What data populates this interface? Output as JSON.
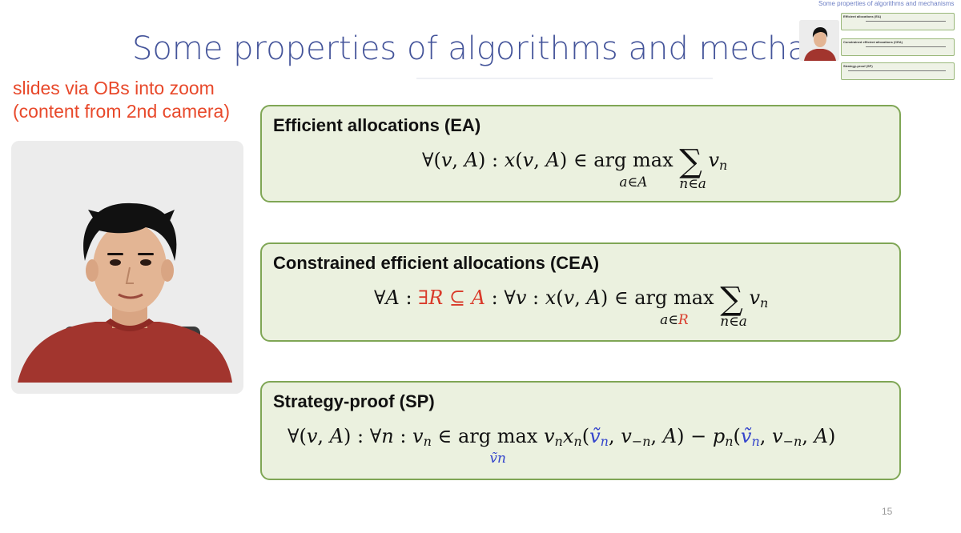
{
  "slide": {
    "title": "Some properties of algorithms and mechanisms",
    "page_number": "15"
  },
  "annotation": {
    "line1": "slides via OBs into zoom",
    "line2": "(content from 2nd camera)"
  },
  "properties": [
    {
      "heading": "Efficient allocations (EA)",
      "formula": "∀(v, A) : x(v, A) ∈ argmax_{a∈A} Σ_{n∈a} v_n"
    },
    {
      "heading": "Constrained efficient allocations (CEA)",
      "formula": "∀A : ∃R ⊆ A : ∀v : x(v, A) ∈ argmax_{a∈R} Σ_{n∈a} v_n"
    },
    {
      "heading": "Strategy-proof (SP)",
      "formula": "∀(v, A) : ∀n : v_n ∈ argmax_{ṽ_n} v_n x_n(ṽ_n, v_−n, A) − p_n(ṽ_n, v_−n, A)"
    }
  ],
  "math": {
    "argmax": "arg max",
    "sum": "∑",
    "sub_a_in_A": "a∈A",
    "sub_n_in_a": "n∈a",
    "sub_a_in_R": "a∈R",
    "sub_vtilde_n": "ṽn"
  },
  "mini_preview": {
    "title": "Some properties of algorithms and mechanisms",
    "box_headings": [
      "Efficient allocations (EA)",
      "Constrained efficient allocations (CEA)",
      "Strategy-proof (SP)"
    ]
  },
  "colors": {
    "title": "#44549a",
    "annotation": "#e8492b",
    "box_fill": "#ebf1df",
    "box_border": "#7fa655",
    "highlight_red": "#d93a2a",
    "highlight_blue": "#3344cc"
  }
}
